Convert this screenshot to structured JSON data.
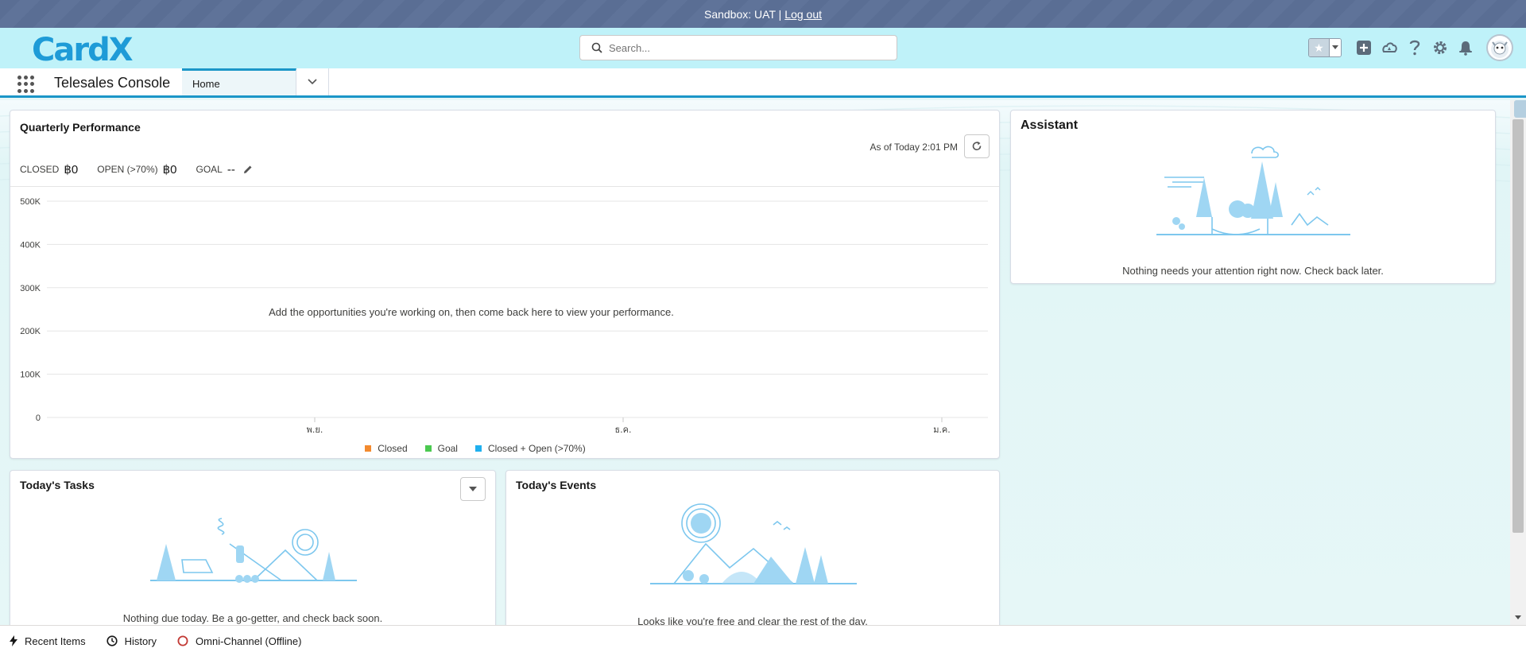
{
  "sandbox": {
    "text": "Sandbox: UAT |",
    "logout": "Log out"
  },
  "header": {
    "logo_text": "CardX",
    "search_placeholder": "Search...",
    "icons": [
      "favorites-star-icon",
      "favorites-dropdown-icon",
      "global-actions-add-icon",
      "trailhead-icon",
      "help-icon",
      "setup-gear-icon",
      "notifications-bell-icon",
      "user-avatar"
    ]
  },
  "nav": {
    "app_name": "Telesales Console",
    "tab_home": "Home"
  },
  "quarterly": {
    "title": "Quarterly Performance",
    "as_of": "As of Today 2:01 PM",
    "closed_label": "CLOSED",
    "closed_value": "฿0",
    "open_label": "OPEN (>70%)",
    "open_value": "฿0",
    "goal_label": "GOAL",
    "goal_value": "--",
    "empty_message": "Add the opportunities you're working on, then come back here to view your performance.",
    "legend": [
      "Closed",
      "Goal",
      "Closed + Open (>70%)"
    ]
  },
  "assistant": {
    "title": "Assistant",
    "message": "Nothing needs your attention right now. Check back later."
  },
  "tasks": {
    "title": "Today's Tasks",
    "message": "Nothing due today. Be a go-getter, and check back soon."
  },
  "events": {
    "title": "Today's Events",
    "message": "Looks like you're free and clear the rest of the day."
  },
  "utility": {
    "recent": "Recent Items",
    "history": "History",
    "omni": "Omni-Channel (Offline)"
  },
  "colors": {
    "closed": "#f38a2e",
    "goal": "#4bc950",
    "closed_open": "#1fb0ef",
    "brand": "#1b96c8"
  },
  "chart_data": {
    "type": "line",
    "title": "",
    "y_ticks": [
      "500K",
      "400K",
      "300K",
      "200K",
      "100K",
      "0"
    ],
    "x_ticks": [
      "พ.ย.",
      "ธ.ค.",
      "ม.ค."
    ],
    "ylim": [
      0,
      500000
    ],
    "series": [
      {
        "name": "Closed",
        "values": []
      },
      {
        "name": "Goal",
        "values": []
      },
      {
        "name": "Closed + Open (>70%)",
        "values": []
      }
    ],
    "grid": true,
    "legend_position": "bottom"
  }
}
